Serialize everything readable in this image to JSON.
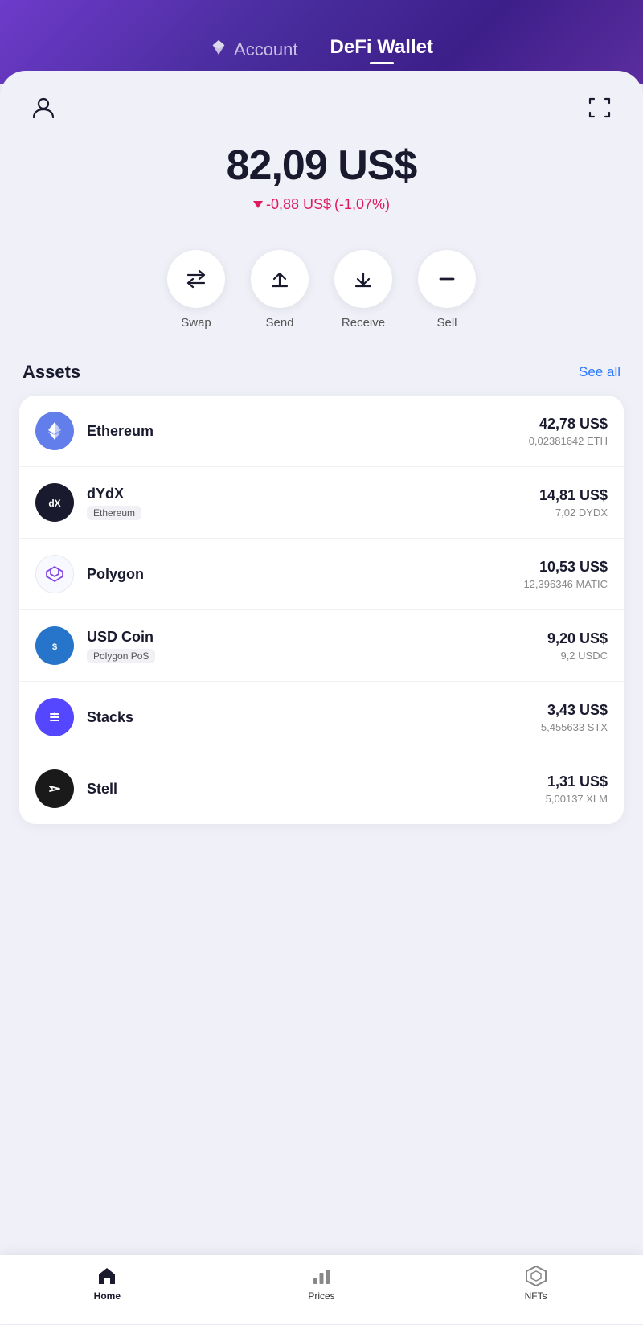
{
  "header": {
    "account_label": "Account",
    "wallet_label": "DeFi Wallet"
  },
  "balance": {
    "amount": "82,09 US$",
    "change_amount": "-0,88 US$",
    "change_percent": "(-1,07%)"
  },
  "actions": [
    {
      "id": "swap",
      "label": "Swap"
    },
    {
      "id": "send",
      "label": "Send"
    },
    {
      "id": "receive",
      "label": "Receive"
    },
    {
      "id": "sell",
      "label": "Sell"
    }
  ],
  "assets_section": {
    "title": "Assets",
    "see_all": "See all"
  },
  "assets": [
    {
      "name": "Ethereum",
      "network": null,
      "usd": "42,78 US$",
      "amount": "0,02381642 ETH",
      "logo_type": "eth"
    },
    {
      "name": "dYdX",
      "network": "Ethereum",
      "usd": "14,81 US$",
      "amount": "7,02 DYDX",
      "logo_type": "dydx"
    },
    {
      "name": "Polygon",
      "network": null,
      "usd": "10,53 US$",
      "amount": "12,396346 MATIC",
      "logo_type": "matic"
    },
    {
      "name": "USD Coin",
      "network": "Polygon PoS",
      "usd": "9,20 US$",
      "amount": "9,2 USDC",
      "logo_type": "usdc"
    },
    {
      "name": "Stacks",
      "network": null,
      "usd": "3,43 US$",
      "amount": "5,455633 STX",
      "logo_type": "stacks"
    },
    {
      "name": "Stell",
      "network": null,
      "usd": "1,31 US$",
      "amount": "5,00137 XLM",
      "logo_type": "stellar"
    }
  ],
  "bottom_nav": [
    {
      "id": "home",
      "label": "Home",
      "active": true
    },
    {
      "id": "prices",
      "label": "Prices",
      "active": false
    },
    {
      "id": "nfts",
      "label": "NFTs",
      "active": false
    }
  ],
  "colors": {
    "accent_blue": "#2979ff",
    "accent_pink": "#e0185c",
    "gradient_start": "#6e3bca",
    "gradient_end": "#3d1f8a"
  }
}
